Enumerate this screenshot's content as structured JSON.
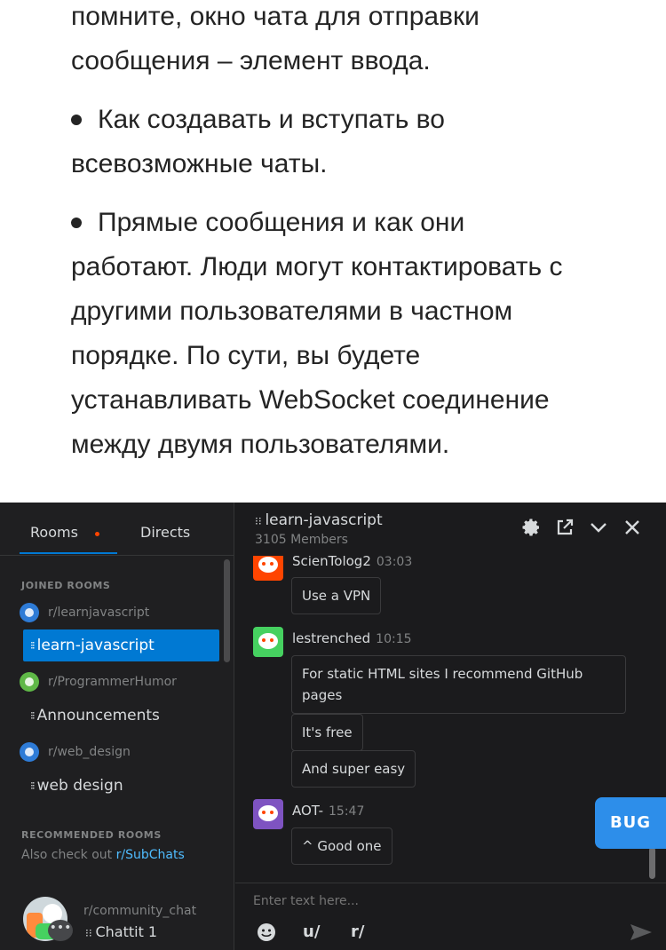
{
  "article": {
    "lines": [
      "помните, окно чата для отправки",
      "сообщения – элемент ввода.",
      "Как создавать и вступать во",
      "всевозможные чаты.",
      "Прямые сообщения и как они",
      "работают. Люди могут контактировать с",
      "другими пользователями в частном",
      "порядке. По сути, вы будете",
      "устанавливать WebSocket соединение",
      "между двумя пользователями."
    ]
  },
  "sidebar": {
    "tabs": {
      "rooms": "Rooms",
      "directs": "Directs"
    },
    "joined_title": "JOINED ROOMS",
    "communities": [
      {
        "name": "r/learnjavascript",
        "room": "learn-javascript",
        "color": "#2e7bd6"
      },
      {
        "name": "r/ProgrammerHumor",
        "room": "Announcements",
        "color": "#5fb847"
      },
      {
        "name": "r/web_design",
        "room": "web design",
        "color": "#2e7bd6"
      }
    ],
    "recommended_title": "RECOMMENDED ROOMS",
    "recommended_prefix": "Also check out",
    "recommended_link": "r/SubChats",
    "user": {
      "subreddit": "r/community_chat",
      "room": "Chattit 1"
    }
  },
  "header": {
    "title": "learn-javascript",
    "members": "3105 Members"
  },
  "messages": [
    {
      "user": "ScienTolog2",
      "time": "03:03",
      "avatar_color": "#ff4500",
      "bubbles": [
        "Use a VPN"
      ]
    },
    {
      "user": "lestrenched",
      "time": "10:15",
      "avatar_color": "#46d160",
      "bubbles": [
        "For static HTML sites I recommend GitHub pages",
        "It's free",
        "And super easy"
      ]
    },
    {
      "user": "AOT-",
      "time": "15:47",
      "avatar_color": "#7e53c1",
      "bubbles": [
        "^ Good one"
      ]
    }
  ],
  "composer": {
    "placeholder": "Enter text here...",
    "user_btn": "u/",
    "sub_btn": "r/"
  },
  "bug_label": "BUG"
}
